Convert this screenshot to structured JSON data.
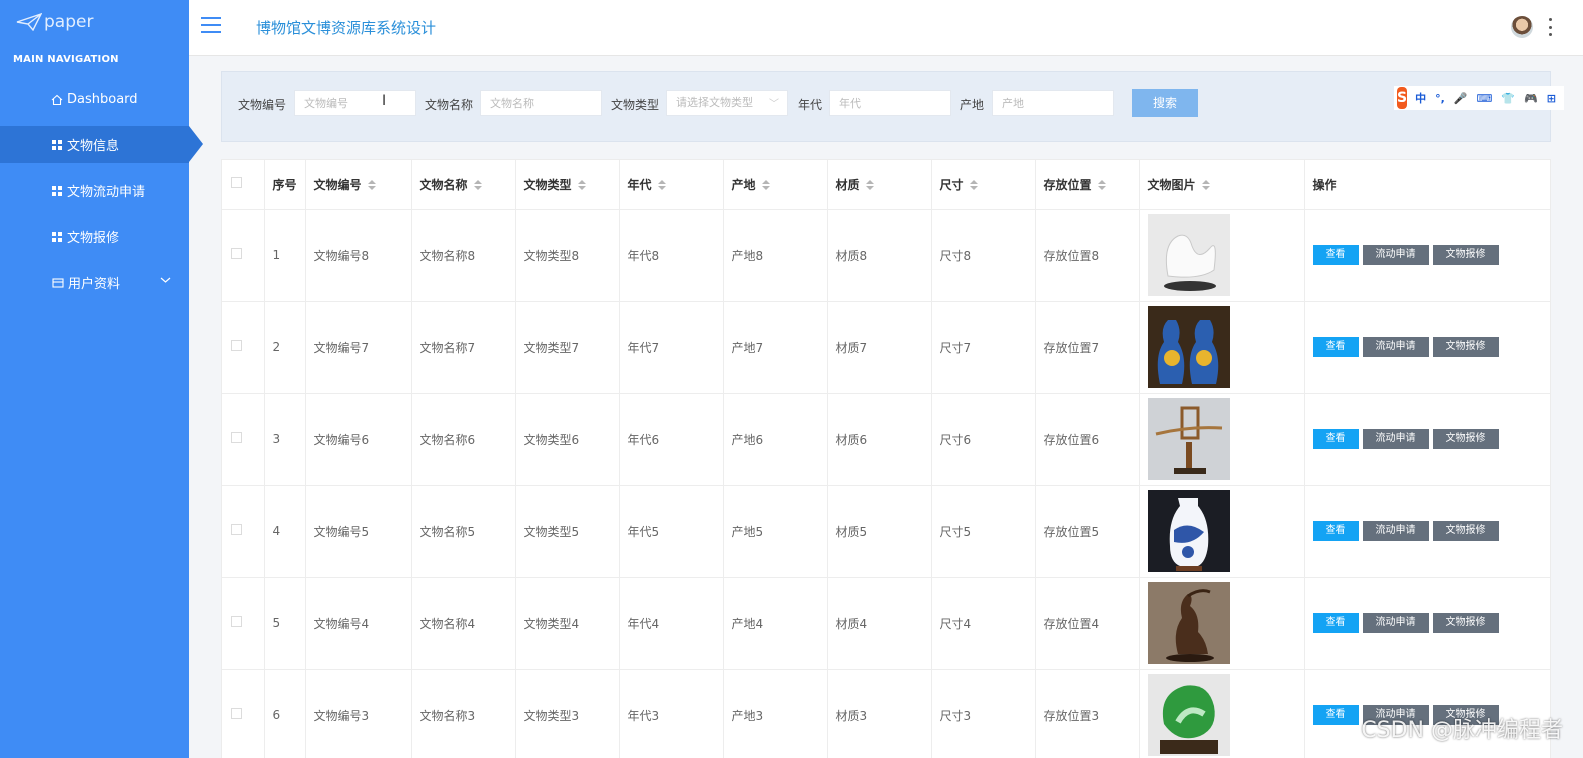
{
  "app": {
    "logo_text": "paper",
    "title": "博物馆文博资源库系统设计"
  },
  "sidebar": {
    "header": "MAIN NAVIGATION",
    "items": [
      {
        "label": "Dashboard",
        "icon": "home-icon"
      },
      {
        "label": "文物信息",
        "icon": "grid-icon",
        "active": true
      },
      {
        "label": "文物流动申请",
        "icon": "grid-icon"
      },
      {
        "label": "文物报修",
        "icon": "grid-icon"
      },
      {
        "label": "用户资料",
        "icon": "id-card-icon",
        "expandable": true
      }
    ]
  },
  "search": {
    "fields": [
      {
        "label": "文物编号",
        "placeholder": "文物编号"
      },
      {
        "label": "文物名称",
        "placeholder": "文物名称"
      },
      {
        "label": "文物类型",
        "placeholder": "请选择文物类型"
      },
      {
        "label": "年代",
        "placeholder": "年代"
      },
      {
        "label": "产地",
        "placeholder": "产地"
      }
    ],
    "button": "搜索"
  },
  "ime": {
    "items": [
      "中",
      "°,",
      "🎤",
      "⌨",
      "👕",
      "🎮",
      "⊞"
    ]
  },
  "table": {
    "columns": [
      "序号",
      "文物编号",
      "文物名称",
      "文物类型",
      "年代",
      "产地",
      "材质",
      "尺寸",
      "存放位置",
      "文物图片",
      "操作"
    ],
    "actions": {
      "view": "查看",
      "flow": "流动申请",
      "repair": "文物报修"
    },
    "rows": [
      {
        "idx": "1",
        "code": "文物编号8",
        "name": "文物名称8",
        "type": "文物类型8",
        "era": "年代8",
        "origin": "产地8",
        "material": "材质8",
        "size": "尺寸8",
        "location": "存放位置8",
        "image": "white-porcelain-sculpture"
      },
      {
        "idx": "2",
        "code": "文物编号7",
        "name": "文物名称7",
        "type": "文物类型7",
        "era": "年代7",
        "origin": "产地7",
        "material": "材质7",
        "size": "尺寸7",
        "location": "存放位置7",
        "image": "cloisonne-vases"
      },
      {
        "idx": "3",
        "code": "文物编号6",
        "name": "文物名称6",
        "type": "文物类型6",
        "era": "年代6",
        "origin": "产地6",
        "material": "材质6",
        "size": "尺寸6",
        "location": "存放位置6",
        "image": "wooden-ornament"
      },
      {
        "idx": "4",
        "code": "文物编号5",
        "name": "文物名称5",
        "type": "文物类型5",
        "era": "年代5",
        "origin": "产地5",
        "material": "材质5",
        "size": "尺寸5",
        "location": "存放位置5",
        "image": "blue-white-vase"
      },
      {
        "idx": "5",
        "code": "文物编号4",
        "name": "文物名称4",
        "type": "文物类型4",
        "era": "年代4",
        "origin": "产地4",
        "material": "材质4",
        "size": "尺寸4",
        "location": "存放位置4",
        "image": "bronze-crane"
      },
      {
        "idx": "6",
        "code": "文物编号3",
        "name": "文物名称3",
        "type": "文物类型3",
        "era": "年代3",
        "origin": "产地3",
        "material": "材质3",
        "size": "尺寸3",
        "location": "存放位置3",
        "image": "jade-cabbage"
      }
    ]
  },
  "watermark": "CSDN @脉冲编程者",
  "colors": {
    "sidebar": "#3f8cf5",
    "sidebar_active": "#2d74d6",
    "title": "#2a8fd9",
    "view_button": "#14a3f4",
    "secondary_button": "#65707d",
    "search_button": "#7fb6ee"
  }
}
